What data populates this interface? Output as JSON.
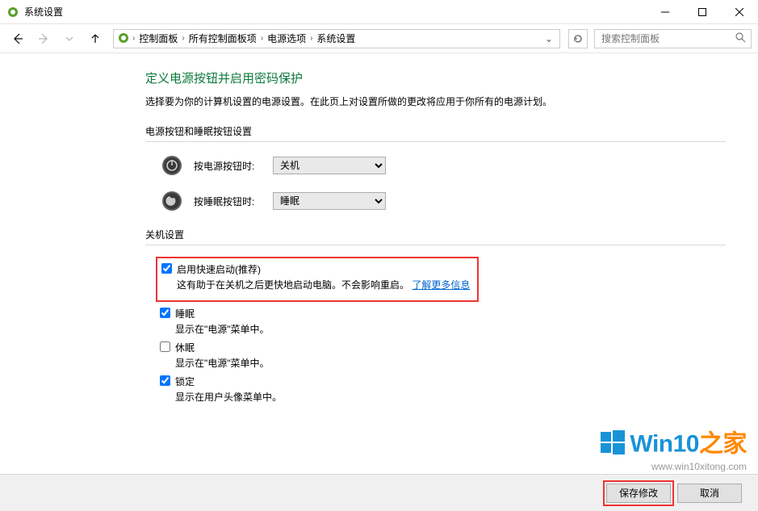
{
  "window": {
    "title": "系统设置"
  },
  "breadcrumb": {
    "items": [
      "控制面板",
      "所有控制面板项",
      "电源选项",
      "系统设置"
    ]
  },
  "search": {
    "placeholder": "搜索控制面板"
  },
  "page": {
    "heading": "定义电源按钮并启用密码保护",
    "description": "选择要为你的计算机设置的电源设置。在此页上对设置所做的更改将应用于你所有的电源计划。"
  },
  "section_buttons": {
    "label": "电源按钮和睡眠按钮设置",
    "rows": [
      {
        "label": "按电源按钮时:",
        "value": "关机"
      },
      {
        "label": "按睡眠按钮时:",
        "value": "睡眠"
      }
    ]
  },
  "section_shutdown": {
    "label": "关机设置",
    "options": [
      {
        "title": "启用快速启动(推荐)",
        "desc_prefix": "这有助于在关机之后更快地启动电脑。不会影响重启。",
        "link_text": "了解更多信息",
        "checked": true,
        "highlighted": true
      },
      {
        "title": "睡眠",
        "desc": "显示在\"电源\"菜单中。",
        "checked": true
      },
      {
        "title": "休眠",
        "desc": "显示在\"电源\"菜单中。",
        "checked": false
      },
      {
        "title": "锁定",
        "desc": "显示在用户头像菜单中。",
        "checked": true
      }
    ]
  },
  "footer": {
    "save": "保存修改",
    "cancel": "取消"
  },
  "watermark": {
    "brand_prefix": "Win10",
    "brand_suffix": "之家",
    "url": "www.win10xitong.com"
  }
}
